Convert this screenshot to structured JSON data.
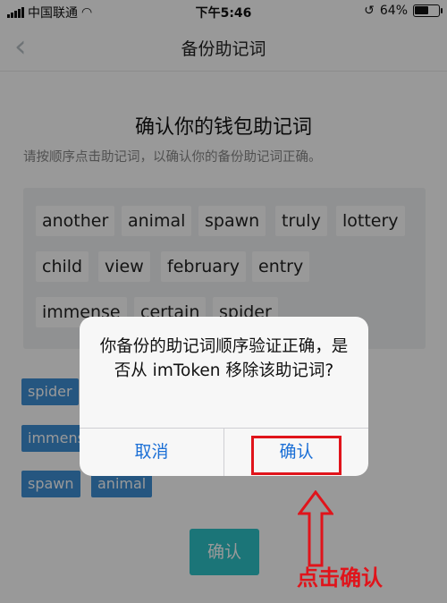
{
  "status": {
    "carrier": "中国联通",
    "time": "下午5:46",
    "battery": "64%",
    "battery_level": 0.64
  },
  "nav": {
    "title": "备份助记词",
    "back_icon": "chevron-left-icon"
  },
  "page": {
    "heading": "确认你的钱包助记词",
    "subheading": "请按顺序点击助记词，以确认你的备份助记词正确。",
    "word_pool": [
      "another",
      "animal",
      "spawn",
      "truly",
      "lottery",
      "child",
      "view",
      "february",
      "entry",
      "immense",
      "certain",
      "spider"
    ],
    "picked_words": [
      "spider",
      "immense",
      "spawn",
      "animal"
    ],
    "confirm_button": "确认"
  },
  "dialog": {
    "message": "你备份的助记词顺序验证正确，是否从 imToken 移除该助记词?",
    "cancel": "取消",
    "confirm": "确认"
  },
  "annotation": {
    "text": "点击确认",
    "color": "#e0141b"
  },
  "colors": {
    "confirm_button": "#2ec3c9",
    "picked_chip": "#3f8fd6",
    "dialog_button": "#1b6fd6"
  }
}
